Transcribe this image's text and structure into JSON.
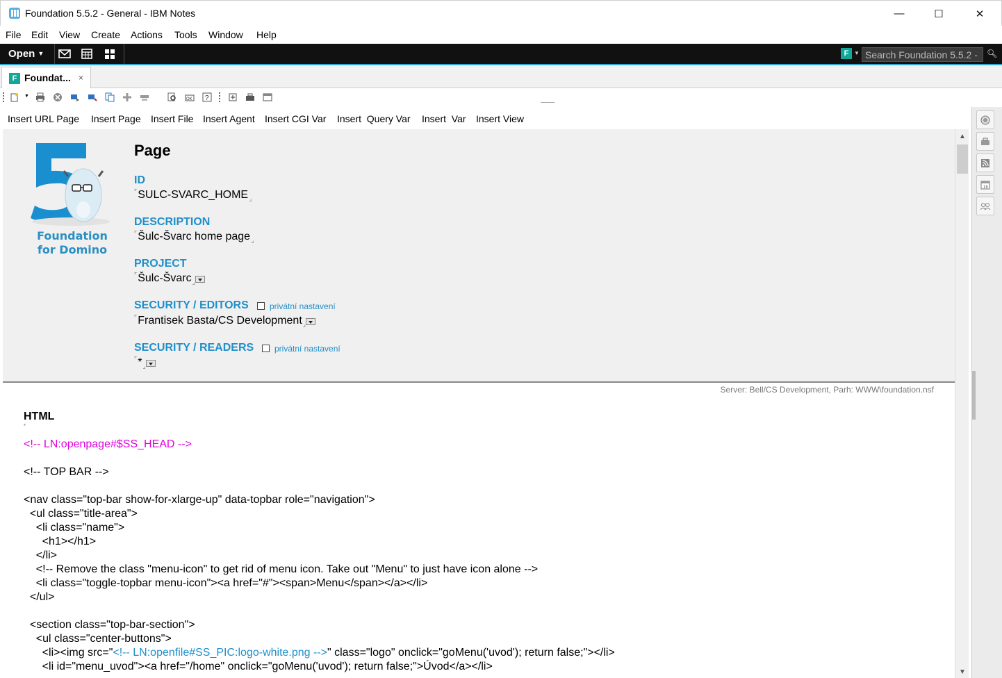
{
  "window": {
    "title": "Foundation 5.5.2 - General - IBM Notes",
    "min_glyph": "—",
    "max_glyph": "☐",
    "close_glyph": "✕"
  },
  "menu": [
    "File",
    "Edit",
    "View",
    "Create",
    "Actions",
    "Tools",
    "Window",
    "Help"
  ],
  "darkbar": {
    "open_label": "Open",
    "search_placeholder": "Search Foundation 5.5.2 -",
    "search_logo_letter": "F"
  },
  "tab": {
    "label": "Foundat...",
    "close_glyph": "×",
    "icon_letter": "F"
  },
  "insert_buttons": [
    "Insert URL Page",
    "Insert Page",
    "Insert File",
    "Insert Agent",
    "Insert CGI Var",
    "Insert  Query Var",
    "Insert  Var",
    "Insert View"
  ],
  "form": {
    "logo_line1": "Foundation",
    "logo_line2": "for Domino",
    "heading": "Page",
    "id_label": "ID",
    "id_value": "SULC-SVARC_HOME",
    "description_label": "DESCRIPTION",
    "description_value": "Šulc-Švarc home page",
    "project_label": "PROJECT",
    "project_value": "Šulc-Švarc",
    "editors_label": "SECURITY / EDITORS",
    "editors_private": "privátní nastavení",
    "editors_value": "Frantisek Basta/CS Development",
    "readers_label": "SECURITY / READERS",
    "readers_private": "privátní nastavení",
    "readers_value": "*"
  },
  "code": {
    "server_line": "Server: Bell/CS Development, Parh: WWW\\foundation.nsf",
    "section_title": "HTML",
    "lines": {
      "l1": "<!-- LN:openpage#$SS_HEAD -->",
      "l2": "<!-- TOP BAR -->",
      "l3": "<nav class=\"top-bar show-for-xlarge-up\" data-topbar role=\"navigation\">",
      "l4": "  <ul class=\"title-area\">",
      "l5": "    <li class=\"name\">",
      "l6": "      <h1></h1>",
      "l7": "    </li>",
      "l8": "    <!-- Remove the class \"menu-icon\" to get rid of menu icon. Take out \"Menu\" to just have icon alone -->",
      "l9": "    <li class=\"toggle-topbar menu-icon\"><a href=\"#\"><span>Menu</span></a></li>",
      "l10": "  </ul>",
      "l11": "  <section class=\"top-bar-section\">",
      "l12": "    <ul class=\"center-buttons\">",
      "l13a": "      <li><img src=\"",
      "l13b": "<!-- LN:openfile#SS_PIC:logo-white.png -->",
      "l13c": "\" class=\"logo\" onclick=\"goMenu('uvod'); return false;\"></li>",
      "l14": "      <li id=\"menu_uvod\"><a href=\"/home\" onclick=\"goMenu('uvod'); return false;\">Úvod</a></li>"
    }
  }
}
